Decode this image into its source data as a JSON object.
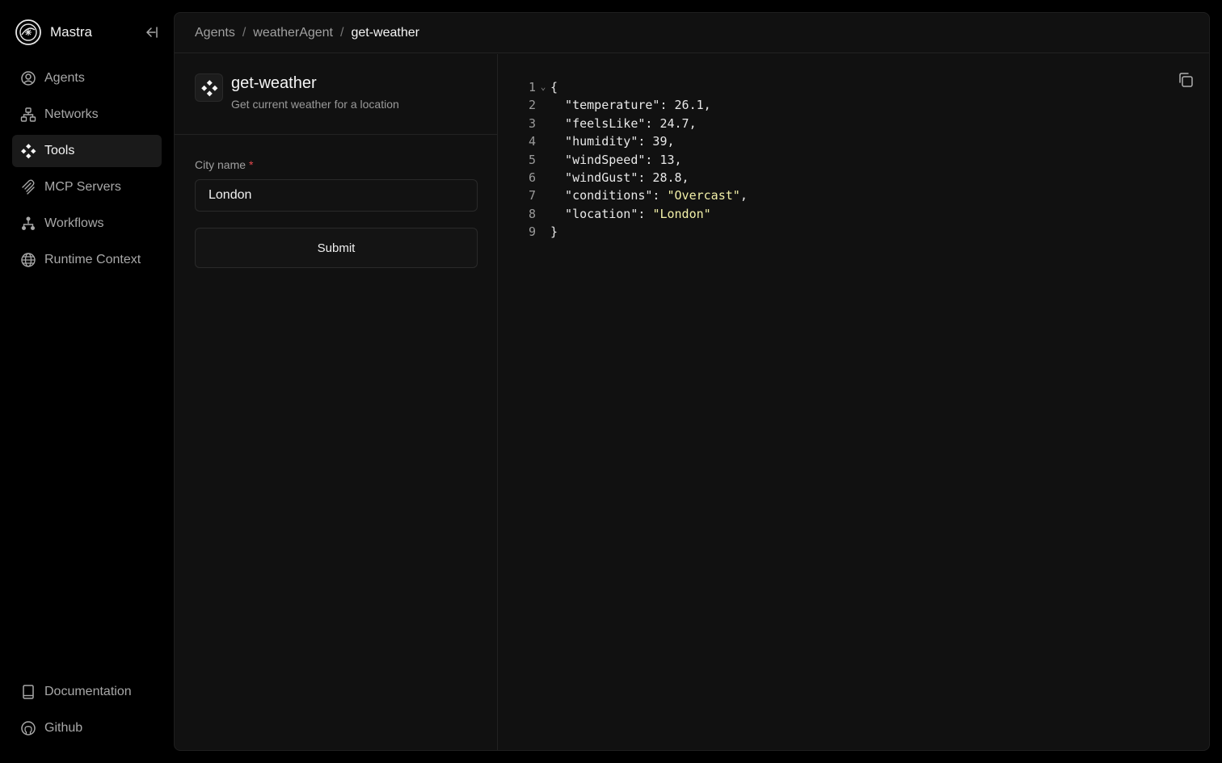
{
  "sidebar": {
    "brand": "Mastra",
    "items": [
      {
        "label": "Agents",
        "icon": "user-circle-icon",
        "active": false
      },
      {
        "label": "Networks",
        "icon": "network-icon",
        "active": false
      },
      {
        "label": "Tools",
        "icon": "tools-icon",
        "active": true
      },
      {
        "label": "MCP Servers",
        "icon": "mcp-icon",
        "active": false
      },
      {
        "label": "Workflows",
        "icon": "workflow-icon",
        "active": false
      },
      {
        "label": "Runtime Context",
        "icon": "globe-icon",
        "active": false
      }
    ],
    "bottom": [
      {
        "label": "Documentation",
        "icon": "book-icon"
      },
      {
        "label": "Github",
        "icon": "github-icon"
      }
    ]
  },
  "breadcrumb": {
    "items": [
      "Agents",
      "weatherAgent",
      "get-weather"
    ],
    "separator": "/"
  },
  "tool": {
    "name": "get-weather",
    "description": "Get current weather for a location"
  },
  "form": {
    "city_label": "City name",
    "required_mark": "*",
    "city_value": "London",
    "submit_label": "Submit"
  },
  "result": {
    "lines": [
      "{",
      "  \"temperature\": 26.1,",
      "  \"feelsLike\": 24.7,",
      "  \"humidity\": 39,",
      "  \"windSpeed\": 13,",
      "  \"windGust\": 28.8,",
      "  \"conditions\": \"Overcast\",",
      "  \"location\": \"London\"",
      "}"
    ],
    "fold_marker": "⌄"
  },
  "colors": {
    "background": "#000000",
    "panel": "#111111",
    "string": "#f2f0a8",
    "required": "#e5484d"
  }
}
